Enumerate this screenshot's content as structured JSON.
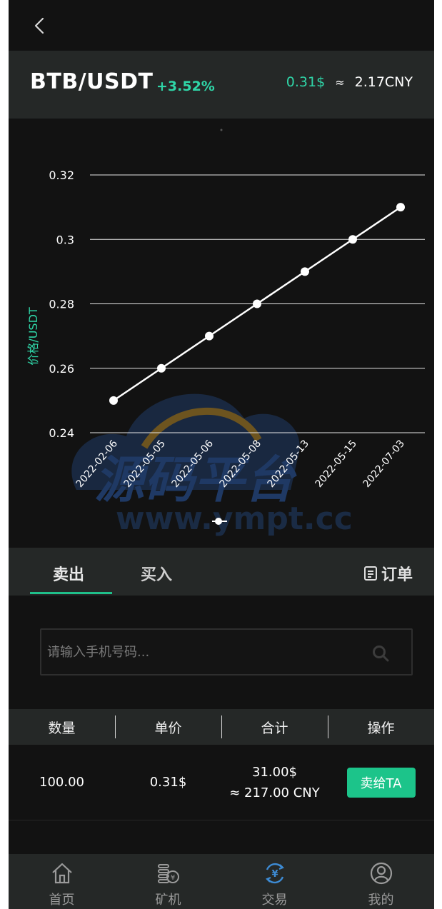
{
  "header": {
    "pair": "BTB/USDT",
    "change": "+3.52%",
    "price_usd": "0.31$",
    "approx": "≈",
    "price_cny": "2.17CNY"
  },
  "colors": {
    "accent": "#2fd6a8",
    "button": "#1cc48a",
    "panel": "#252827",
    "background": "#121212"
  },
  "chart_data": {
    "type": "line",
    "ylabel": "价格/USDT",
    "x": [
      "2022-02-06",
      "2022-05-05",
      "2022-05-06",
      "2022-05-08",
      "2022-05-13",
      "2022-05-15",
      "2022-07-03"
    ],
    "series": [
      {
        "values": [
          0.25,
          0.26,
          0.27,
          0.28,
          0.29,
          0.3,
          0.31
        ]
      }
    ],
    "yticks": [
      "0.24",
      "0.26",
      "0.28",
      "0.3",
      "0.32"
    ],
    "ylim": [
      0.24,
      0.32
    ],
    "grid": true,
    "watermark": {
      "title": "源码平台",
      "url": "www.ympt.cc"
    }
  },
  "tabs": {
    "sell": "卖出",
    "buy": "买入",
    "orders": "订单"
  },
  "search": {
    "placeholder": "请输入手机号码..."
  },
  "table": {
    "headers": [
      "数量",
      "单价",
      "合计",
      "操作"
    ],
    "rows": [
      {
        "quantity": "100.00",
        "unit_price": "0.31$",
        "total_usd": "31.00$",
        "total_cny": "≈  217.00 CNY",
        "action": "卖给TA"
      }
    ]
  },
  "nav": {
    "items": [
      {
        "label": "首页",
        "icon": "home-icon"
      },
      {
        "label": "矿机",
        "icon": "miner-icon"
      },
      {
        "label": "交易",
        "icon": "trade-icon"
      },
      {
        "label": "我的",
        "icon": "user-icon"
      }
    ]
  }
}
